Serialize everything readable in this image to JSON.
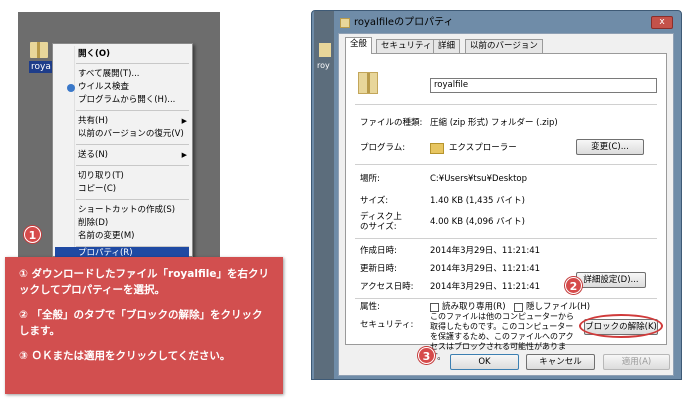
{
  "left": {
    "desktop_label": "roya",
    "menu": {
      "open": "開く(O)",
      "expand_all": "すべて展開(T)...",
      "virus_scan": "ウイルス検査",
      "open_with": "プログラムから開く(H)...",
      "share": "共有(H)",
      "restore": "以前のバージョンの復元(V)",
      "send_to": "送る(N)",
      "cut": "切り取り(T)",
      "copy": "コピー(C)",
      "create_shortcut": "ショートカットの作成(S)",
      "delete": "削除(D)",
      "rename": "名前の変更(M)",
      "properties": "プロパティ(R)"
    }
  },
  "badges": {
    "one": "1",
    "two": "2",
    "three": "3"
  },
  "instructions": [
    "① ダウンロードしたファイル「royalfile」を右クリックしてプロパティーを選択。",
    "② 「全般」のタブで「ブロックの解除」をクリックします。",
    "③ ＯＫまたは適用をクリックしてください。"
  ],
  "bg_label": "roy",
  "dialog": {
    "title": "royalfileのプロパティ",
    "close": "x",
    "tabs": [
      "全般",
      "セキュリティ",
      "詳細",
      "以前のバージョン"
    ],
    "filename": "royalfile",
    "file_type_label": "ファイルの種類:",
    "file_type_value": "圧縮 (zip 形式) フォルダー (.zip)",
    "program_label": "プログラム:",
    "program_value": "エクスプローラー",
    "change_button": "変更(C)...",
    "location_label": "場所:",
    "location_value": "C:¥Users¥tsu¥Desktop",
    "size_label": "サイズ:",
    "size_value": "1.40 KB (1,435 バイト)",
    "disk_size_label_1": "ディスク上",
    "disk_size_label_2": "のサイズ:",
    "disk_size_value": "4.00 KB (4,096 バイト)",
    "created_label": "作成日時:",
    "created_value": "2014年3月29日、11:21:41",
    "modified_label": "更新日時:",
    "modified_value": "2014年3月29日、11:21:41",
    "accessed_label": "アクセス日時:",
    "accessed_value": "2014年3月29日、11:21:41",
    "attributes_label": "属性:",
    "readonly_label": "読み取り専用(R)",
    "hidden_label": "隠しファイル(H)",
    "advanced_button": "詳細設定(D)...",
    "security_label": "セキュリティ:",
    "security_text": "このファイルは他のコンピューターから取得したものです。このコンピューターを保護するため、このファイルへのアクセスはブロックされる可能性があります。",
    "unblock_button": "ブロックの解除(K)",
    "ok_button": "OK",
    "cancel_button": "キャンセル",
    "apply_button": "適用(A)"
  }
}
